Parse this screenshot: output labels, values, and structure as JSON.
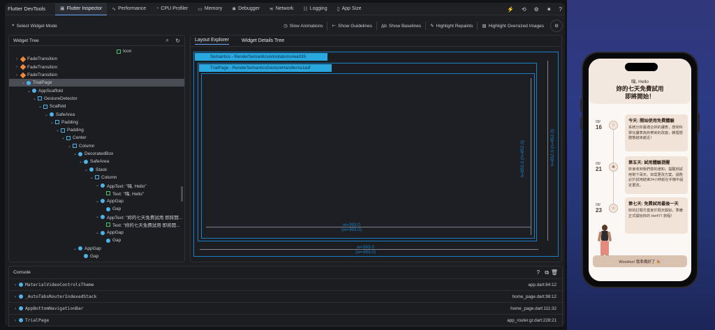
{
  "app": {
    "title": "Flutter DevTools"
  },
  "tabs": [
    {
      "label": "Flutter Inspector",
      "icon": "inspector-icon",
      "glyph": "▣"
    },
    {
      "label": "Performance",
      "icon": "performance-icon",
      "glyph": "∿"
    },
    {
      "label": "CPU Profiler",
      "icon": "cpu-icon",
      "glyph": "◔"
    },
    {
      "label": "Memory",
      "icon": "memory-icon",
      "glyph": "▭"
    },
    {
      "label": "Debugger",
      "icon": "debugger-icon",
      "glyph": "✱"
    },
    {
      "label": "Network",
      "icon": "network-icon",
      "glyph": "≋"
    },
    {
      "label": "Logging",
      "icon": "logging-icon",
      "glyph": "☷"
    },
    {
      "label": "App Size",
      "icon": "app-size-icon",
      "glyph": "▯"
    }
  ],
  "titlebar_icons": [
    "⚡",
    "⟲",
    "⚙",
    "✷",
    "?"
  ],
  "toolbar": {
    "select_widget": "Select Widget Mode",
    "slow_animations": "Slow Animations",
    "show_guidelines": "Show Guidelines",
    "show_baselines": "Show Baselines",
    "highlight_repaints": "Highlight Repaints",
    "highlight_images": "Highlight Oversized Images"
  },
  "widget_tree": {
    "title": "Widget Tree",
    "rows": [
      {
        "label": "Icon",
        "type": "sqg",
        "indent": 147,
        "chev": ""
      },
      {
        "label": "FadeTransition",
        "type": "dia",
        "indent": 10,
        "chev": "›"
      },
      {
        "label": "FadeTransition",
        "type": "dia",
        "indent": 10,
        "chev": "›"
      },
      {
        "label": "FadeTransition",
        "type": "dia",
        "indent": 10,
        "chev": "›"
      },
      {
        "label": "TrialPage",
        "type": "dot",
        "indent": 18,
        "chev": "⌄",
        "selected": true
      },
      {
        "label": "AppScaffold",
        "type": "dot",
        "indent": 26,
        "chev": "⌄"
      },
      {
        "label": "GestureDetector",
        "type": "sq",
        "indent": 34,
        "chev": "⌄"
      },
      {
        "label": "Scaffold",
        "type": "sq",
        "indent": 42,
        "chev": "⌄"
      },
      {
        "label": "SafeArea",
        "type": "dot",
        "indent": 51,
        "chev": "⌄"
      },
      {
        "label": "Padding",
        "type": "sq",
        "indent": 59,
        "chev": "⌄"
      },
      {
        "label": "Padding",
        "type": "sq",
        "indent": 67,
        "chev": "⌄"
      },
      {
        "label": "Center",
        "type": "sq",
        "indent": 75,
        "chev": "⌄"
      },
      {
        "label": "Column",
        "type": "sq",
        "indent": 84,
        "chev": "⌄"
      },
      {
        "label": "DecoratedBox",
        "type": "dot",
        "indent": 92,
        "chev": "⌄"
      },
      {
        "label": "SafeArea",
        "type": "dot",
        "indent": 100,
        "chev": "⌄"
      },
      {
        "label": "Stack",
        "type": "dot",
        "indent": 108,
        "chev": "⌄"
      },
      {
        "label": "Column",
        "type": "sq",
        "indent": 116,
        "chev": "⌄"
      },
      {
        "label": "AppText: \"嗨, Hello\"",
        "type": "dot",
        "indent": 124,
        "chev": "⌄"
      },
      {
        "label": "Text: \"嗨, Hello\"",
        "type": "sqg",
        "indent": 132,
        "chev": ""
      },
      {
        "label": "AppGap",
        "type": "dot",
        "indent": 124,
        "chev": "⌄"
      },
      {
        "label": "Gap",
        "type": "dot",
        "indent": 132,
        "chev": ""
      },
      {
        "label": "AppText: \"妳的七天免費試用 即將開...",
        "type": "dot",
        "indent": 124,
        "chev": "⌄"
      },
      {
        "label": "Text: \"妳的七天免費試用 即將開...",
        "type": "sqg",
        "indent": 132,
        "chev": ""
      },
      {
        "label": "AppGap",
        "type": "dot",
        "indent": 124,
        "chev": "⌄"
      },
      {
        "label": "Gap",
        "type": "dot",
        "indent": 132,
        "chev": ""
      },
      {
        "label": "AppGap",
        "type": "dot",
        "indent": 92,
        "chev": "⌄"
      },
      {
        "label": "Gap",
        "type": "dot",
        "indent": 100,
        "chev": ""
      }
    ]
  },
  "layout": {
    "tab_explorer": "Layout Explorer",
    "tab_details": "Widget Details Tree",
    "semantics_label": "Semantics - RenderSemanticsAnnotations#ea035",
    "trial_label": "TrialPage - RenderSemanticsGestureHandler#a1adf",
    "inner_w": "w=393.0",
    "inner_w2": "(w=393.0)",
    "outer_w": "w=393.0",
    "outer_w2": "(w=393.0)",
    "inner_h": "h=852.0",
    "inner_h2": "(h=852.0)",
    "outer_h": "h=852.0",
    "outer_h2": "(h=852.0)"
  },
  "console": {
    "title": "Console",
    "rows": [
      {
        "label": "MaterialVideoControlsTheme",
        "loc": "app.dart:84:12"
      },
      {
        "label": "_AutoTabsRouterIndexedStack",
        "loc": "home_page.dart:98:12"
      },
      {
        "label": "AppBottomNavigationBar",
        "loc": "home_page.dart:111:32"
      },
      {
        "label": "TrialPage",
        "loc": "app_router.gr.dart:228:21"
      }
    ]
  },
  "phone": {
    "greeting": "嗨, Hello",
    "headline1": "妳的七天免費試用",
    "headline2": "即將開始！",
    "items": [
      {
        "month": "09/",
        "day": "16",
        "title": "今天: 開始使用免費體驗",
        "body": "系統分析最適合妳的課表，感受科學化課表為妳帶來的改變，朝理想體態越來越近！",
        "glyph": "♢"
      },
      {
        "month": "09/",
        "day": "21",
        "title": "第五天: 試用體驗提醒",
        "body": "妳會收到我們發的通知，提醒妳試用剩下兩天。如需更改方案，請務必於試用結束24小時前在手機中設定更改。",
        "glyph": "✻"
      },
      {
        "month": "09/",
        "day": "23",
        "title": "第七天: 免費試用最後一天",
        "body": "妳的訂閱方案會於隔天開始，準備正式開始妳的 HerFIT 旅程！",
        "glyph": "☆"
      }
    ],
    "cta": "WooHoo! 我準備好了 🎉"
  },
  "colors": {
    "accent": "#6ea8fe",
    "layout_blue": "#1a7fc9",
    "label_bg": "#29a8e0",
    "phone_cta": "#d9c2b0"
  }
}
